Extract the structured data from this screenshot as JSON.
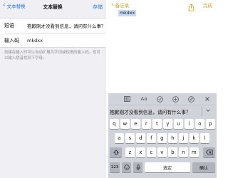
{
  "left_screen": {
    "nav": {
      "back_label": "文本替换",
      "title": "文本替换",
      "save_label": "存储"
    },
    "form": {
      "phrase_label": "短语",
      "phrase_value": "抱歉刚才没看到信息，请问有什么事？",
      "shortcut_label": "输入码",
      "shortcut_value": "mkdxx"
    },
    "footer_note": "创建在输入时可以自动扩展为字词或短语的输入码。也可以输入拼音找到下字母。"
  },
  "right_screen": {
    "nav": {
      "back_label": "备忘录",
      "share_icon": "share-icon",
      "done_label": "完成"
    },
    "note_text": "mkdxx",
    "toolbar_icons": [
      "table-icon",
      "text-format-icon",
      "checklist-icon",
      "add-icon",
      "pen-icon",
      "close-icon"
    ],
    "toolbar_text_format": "Aa",
    "suggestion": "抱歉刚才没看到信息，请问有什么事？",
    "keyboard": {
      "row1": [
        "q",
        "w",
        "e",
        "r",
        "t",
        "y",
        "u",
        "i",
        "o",
        "p"
      ],
      "row2": [
        "a",
        "s",
        "d",
        "f",
        "g",
        "h",
        "j",
        "k",
        "l"
      ],
      "row3": [
        "z",
        "x",
        "c",
        "v",
        "b",
        "n",
        "m"
      ],
      "numbers_key": "123",
      "space_label": "选定",
      "return_label": "确认"
    }
  }
}
